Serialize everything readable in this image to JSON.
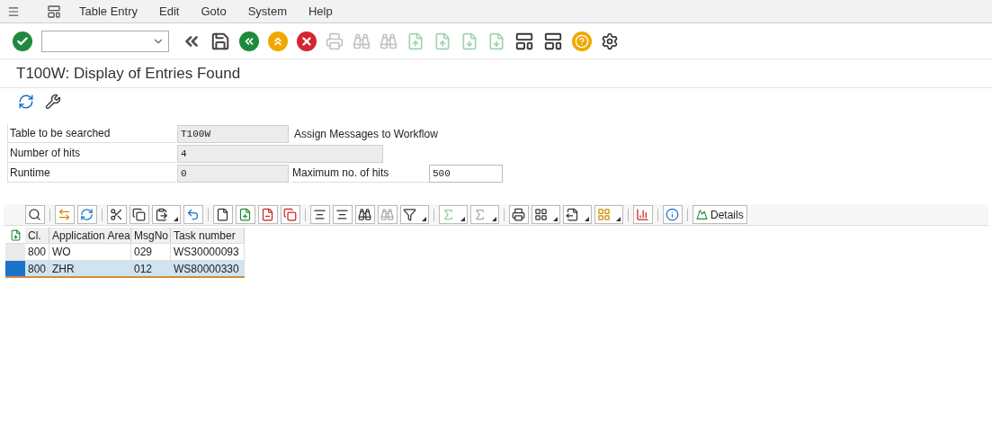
{
  "menu": [
    {
      "label": "Table Entry"
    },
    {
      "label": "Edit"
    },
    {
      "label": "Goto"
    },
    {
      "label": "System"
    },
    {
      "label": "Help"
    }
  ],
  "standard_toolbar": {
    "buttons": [
      {
        "disabled": false
      },
      {
        "disabled": false
      },
      {
        "disabled": false
      },
      {
        "disabled": false
      },
      {
        "disabled": false
      },
      {
        "disabled": true
      },
      {
        "disabled": true
      },
      {
        "disabled": true
      },
      {
        "disabled": true
      },
      {
        "disabled": true
      },
      {
        "disabled": true
      },
      {
        "disabled": true
      },
      {
        "disabled": false
      },
      {
        "disabled": false
      },
      {
        "disabled": false
      },
      {
        "disabled": false
      }
    ]
  },
  "title": "T100W: Display of Entries Found",
  "form": {
    "rows": [
      {
        "label": "Table to be searched",
        "value": "T100W",
        "description": "Assign Messages to Workflow"
      },
      {
        "label": "Number of hits",
        "value": "4"
      },
      {
        "label": "Runtime",
        "value": "0",
        "extra_label": "Maximum no. of hits",
        "extra_value": "500"
      }
    ]
  },
  "alv_toolbar": {
    "details_label": "Details"
  },
  "table": {
    "columns": [
      "Cl.",
      "Application Area",
      "MsgNo",
      "Task number"
    ],
    "rows": [
      {
        "cells": [
          "800",
          "WO",
          "029",
          "WS30000093"
        ],
        "selected": false
      },
      {
        "cells": [
          "800",
          "ZHR",
          "012",
          "WS80000330"
        ],
        "selected": true
      }
    ]
  }
}
